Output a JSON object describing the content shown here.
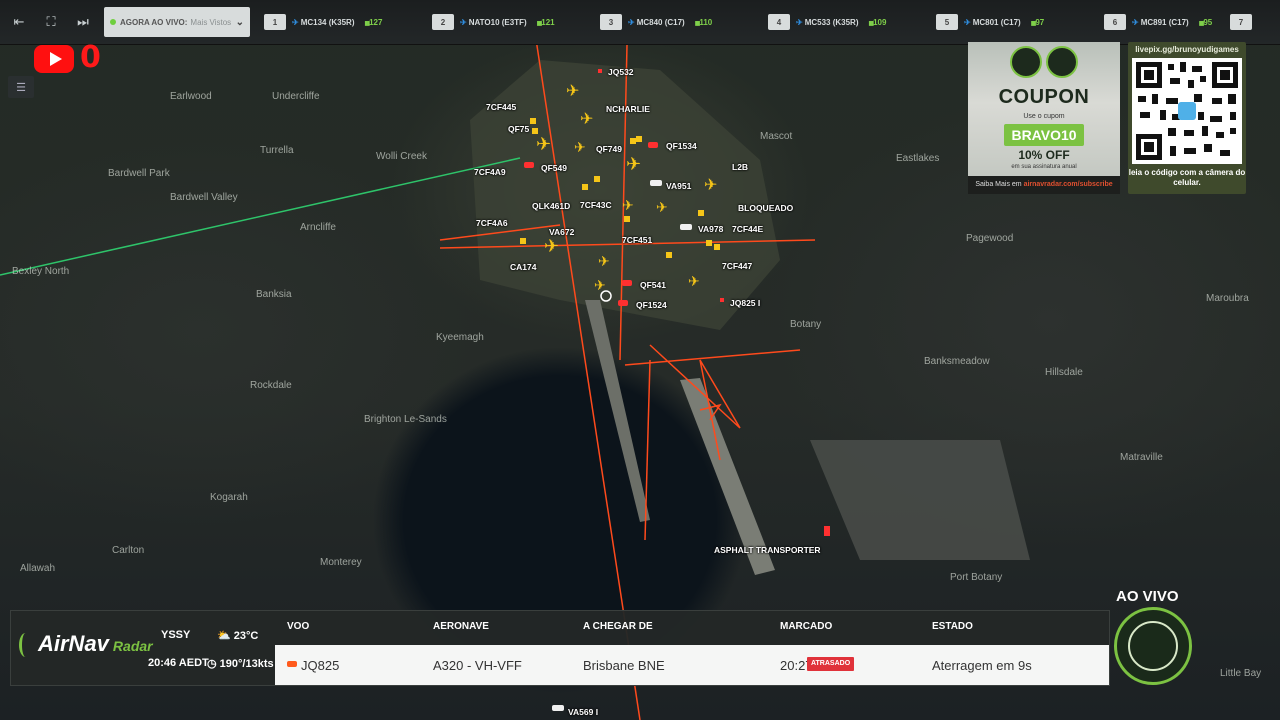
{
  "topbar": {
    "live_select": {
      "main": "AGORA AO VIVO:",
      "sub": "Mais Vistos"
    },
    "slots": [
      {
        "num": "1",
        "callsign": "MC134 (K35R)",
        "count": "127"
      },
      {
        "num": "2",
        "callsign": "NATO10 (E3TF)",
        "count": "121"
      },
      {
        "num": "3",
        "callsign": "MC840 (C17)",
        "count": "110"
      },
      {
        "num": "4",
        "callsign": "MC533 (K35R)",
        "count": "109"
      },
      {
        "num": "5",
        "callsign": "MC801 (C17)",
        "count": "97"
      },
      {
        "num": "6",
        "callsign": "MC891 (C17)",
        "count": "95"
      },
      {
        "num": "7",
        "callsign": "",
        "count": ""
      }
    ]
  },
  "youtube": {
    "count": "0"
  },
  "map": {
    "places": [
      "Earlwood",
      "Undercliffe",
      "Turrella",
      "Wolli Creek",
      "Bardwell Park",
      "Bardwell Valley",
      "Arncliffe",
      "Bexley North",
      "Banksia",
      "Kyeemagh",
      "Rockdale",
      "Brighton Le-Sands",
      "Kogarah",
      "Carlton",
      "Monterey",
      "Allawah",
      "Mascot",
      "Eastlakes",
      "Pagewood",
      "Maroubra",
      "Botany",
      "Banksmeadow",
      "Hillsdale",
      "Matraville",
      "Port Botany",
      "Little Bay"
    ],
    "flights": [
      "JQ532",
      "7CF445",
      "NCHARLIE",
      "QF75",
      "QF749",
      "QF1534",
      "7CF4A9",
      "QF549",
      "L2B",
      "VA951",
      "QLK461D",
      "7CF43C",
      "BLOQUEADO",
      "7CF4A6",
      "VA672",
      "VA978",
      "7CF44E",
      "7CF451",
      "CA174",
      "7CF447",
      "QF541",
      "QF1524",
      "JQ825 I",
      "ASPHALT TRANSPORTER",
      "VA569 I"
    ]
  },
  "coupon": {
    "title": "COUPON",
    "subtitle": "Use o cupom",
    "code": "BRAVO10",
    "discount": "10% OFF",
    "fine_print": "em sua assinatura anual",
    "footer_prefix": "Saiba Mais em",
    "footer_link": "airnavradar.com/subscribe"
  },
  "qr": {
    "url": "livepix.gg/brunoyudigames",
    "caption": "leia o código com a câmera do celular."
  },
  "info": {
    "logo": "AirNav",
    "logo_suffix": "Radar",
    "airport": "YSSY",
    "time": "20:46 AEDT",
    "temp": "23°C",
    "wind": "190°/13kts",
    "headers": {
      "flight": "VOO",
      "aircraft": "AERONAVE",
      "from": "A CHEGAR DE",
      "scheduled": "MARCADO",
      "status": "ESTADO"
    },
    "row": {
      "flight": "JQ825",
      "aircraft": "A320 - VH-VFF",
      "from": "Brisbane BNE",
      "scheduled": "20:27",
      "late": "ATRASADO",
      "status": "Aterragem em 9s"
    }
  },
  "aovivo": {
    "label": "AO VIVO"
  },
  "colors": {
    "accent": "#7cc242",
    "track": "#ff4a1c",
    "plane": "#f5c518",
    "late": "#e0323a"
  }
}
